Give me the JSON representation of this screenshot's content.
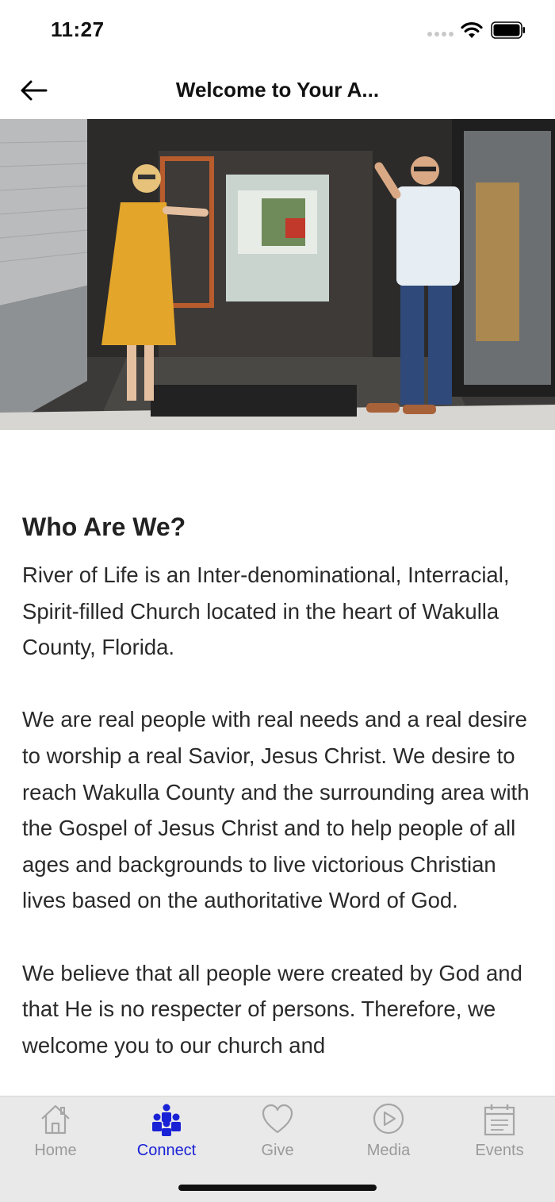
{
  "status": {
    "time": "11:27"
  },
  "nav": {
    "title": "Welcome to Your A..."
  },
  "hero": {
    "image": "church-entrance-greeters-photo"
  },
  "content": {
    "heading": "Who Are We?",
    "paragraphs": [
      "River of Life is an Inter-denominational, Interracial, Spirit-filled Church located in the heart of Wakulla County, Florida.",
      "We are real people with real needs and a real desire to worship a real Savior, Jesus Christ. We desire to reach Wakulla County and the surrounding area with the Gospel of Jesus Christ and to help people of all ages and backgrounds to live victorious Christian lives based on the authoritative Word of God.",
      "We believe that all people were created by God and that He is no respecter of persons. Therefore, we welcome you to our church and"
    ]
  },
  "tabs": [
    {
      "label": "Home",
      "icon": "home-icon",
      "active": false
    },
    {
      "label": "Connect",
      "icon": "people-icon",
      "active": true
    },
    {
      "label": "Give",
      "icon": "heart-icon",
      "active": false
    },
    {
      "label": "Media",
      "icon": "play-icon",
      "active": false
    },
    {
      "label": "Events",
      "icon": "calendar-icon",
      "active": false
    }
  ],
  "colors": {
    "accent": "#1a22d6",
    "tab_inactive": "#9a9a9a",
    "tab_bar_bg": "#e9e9e9"
  }
}
